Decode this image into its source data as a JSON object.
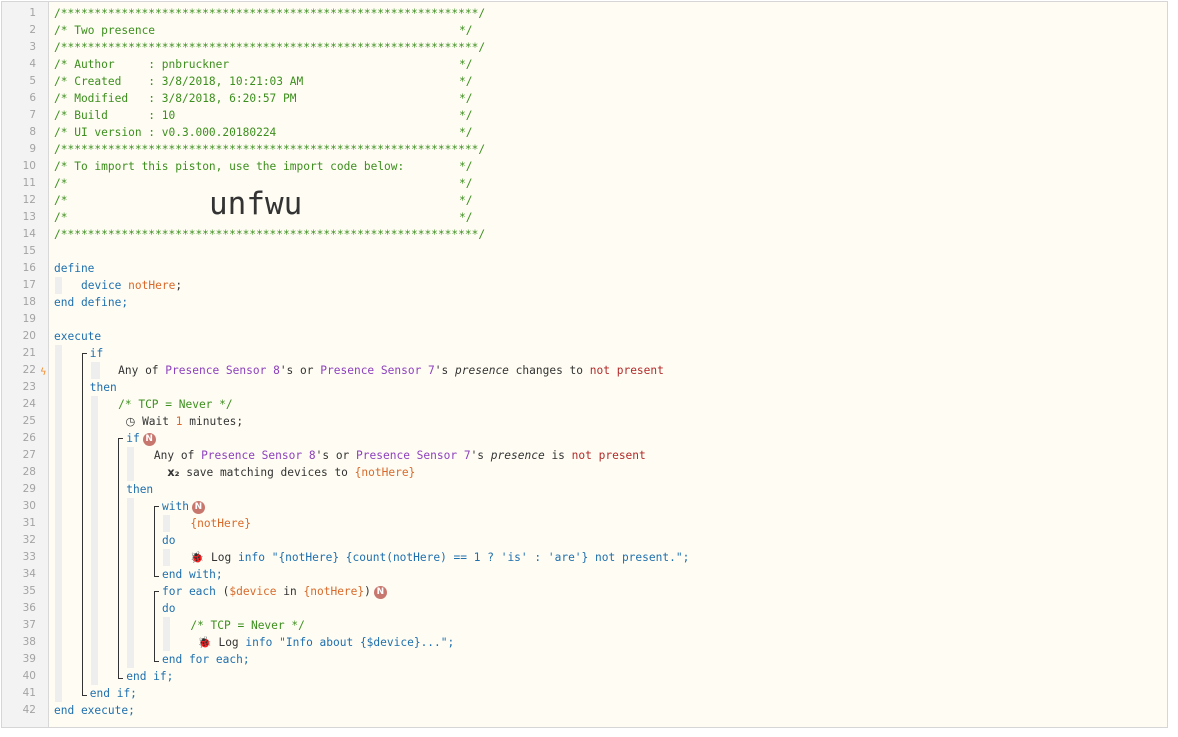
{
  "header": {
    "title": "Two presence",
    "author": "pnbruckner",
    "created": "3/8/2018, 10:21:03 AM",
    "modified": "3/8/2018, 6:20:57 PM",
    "build": "10",
    "ui_version": "v0.3.000.20180224",
    "import_text": "To import this piston, use the import code below:",
    "import_code": "unfwu"
  },
  "icons": {
    "gutter_marker": "lightning-bolt-icon",
    "wait": "clock-icon",
    "log": "bug-icon",
    "save": "variable-x2-icon",
    "badge": "N"
  },
  "colors": {
    "comment": "#3c8f1e",
    "keyword": "#1e6fae",
    "variable": "#d8692a",
    "device": "#8d3fbd",
    "value": "#b22a2a"
  },
  "code": {
    "define": "define",
    "device_type": "device",
    "var_name": "notHere",
    "end_define": "end define;",
    "execute": "execute",
    "if": "if",
    "then": "then",
    "cond_any_of": "Any of",
    "sensor8": "Presence Sensor 8",
    "sensor7": "Presence Sensor 7",
    "possessive": "'s",
    "or": "or",
    "attr_presence": "presence",
    "changes_to": "changes to",
    "is": "is",
    "not_present": "not present",
    "tcp_never": "/* TCP = Never */",
    "wait_label": "Wait",
    "wait_value": "1",
    "wait_unit": "minutes;",
    "save_text": "save matching devices to",
    "var_ref": "{notHere}",
    "with": "with",
    "do": "do",
    "end_with": "end with;",
    "log": "Log",
    "info": "info",
    "log_msg1": "\"{notHere} {count(notHere) == 1 ? 'is' : 'are'} not present.\";",
    "for_each": "for each",
    "device_var": "$device",
    "in": "in",
    "end_for_each": "end for each;",
    "log_msg2": "\"Info about {$device}...\";",
    "end_if": "end if;",
    "end_execute": "end execute;"
  }
}
